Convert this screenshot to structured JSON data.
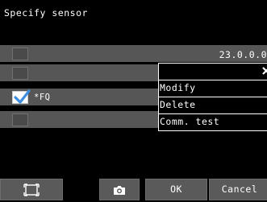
{
  "title": "Specify sensor",
  "sensor_rows": [
    {
      "checked": false,
      "text": "23.0.0.0"
    },
    {
      "checked": false,
      "text": ""
    },
    {
      "checked": true,
      "text": "*FQ"
    },
    {
      "checked": false,
      "text": ""
    }
  ],
  "context_menu": {
    "close_icon": "close-icon",
    "items": [
      "Modify",
      "Delete",
      "Comm. test"
    ]
  },
  "toolbar": {
    "frame_icon": "frame-select-icon",
    "camera_icon": "camera-icon",
    "ok_label": "OK",
    "cancel_label": "Cancel"
  },
  "colors": {
    "background": "#000000",
    "row": "#565656",
    "check_accent": "#3d8de0",
    "button": "#5a5a5a"
  }
}
